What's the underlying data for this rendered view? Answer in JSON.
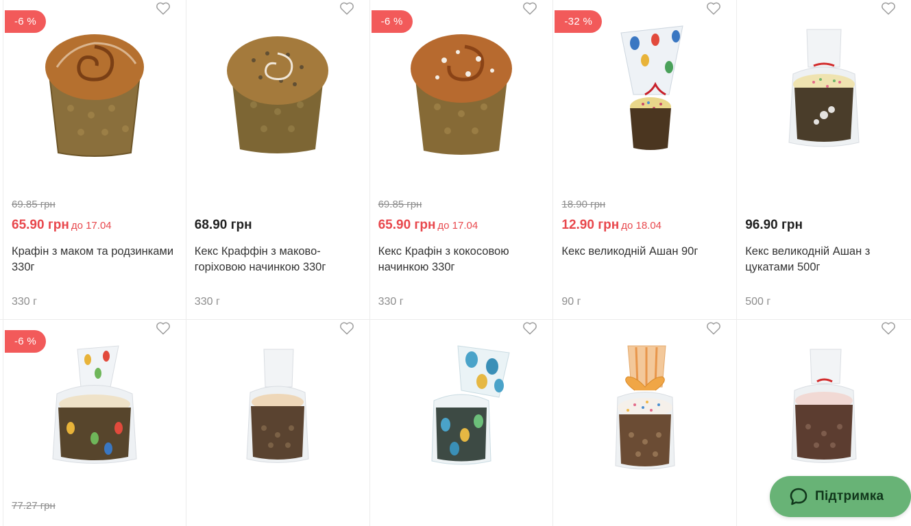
{
  "products_row1": [
    {
      "badge": "-6 %",
      "old_price": "69.85 грн",
      "price": "65.90 грн",
      "until": "до 17.04",
      "title": "Крафін з маком та родзинками 330г",
      "weight": "330 г"
    },
    {
      "badge": "",
      "old_price": "",
      "price": "68.90 грн",
      "until": "",
      "title": "Кекс Краффін з маково-горіховою начинкою 330г",
      "weight": "330 г"
    },
    {
      "badge": "-6 %",
      "old_price": "69.85 грн",
      "price": "65.90 грн",
      "until": "до 17.04",
      "title": "Кекс Крафін з кокосовою начинкою 330г",
      "weight": "330 г"
    },
    {
      "badge": "-32 %",
      "old_price": "18.90 грн",
      "price": "12.90 грн",
      "until": "до 18.04",
      "title": "Кекс великодній Ашан 90г",
      "weight": "90 г"
    },
    {
      "badge": "",
      "old_price": "",
      "price": "96.90 грн",
      "until": "",
      "title": "Кекс великодній Ашан з цукатами 500г",
      "weight": "500 г"
    }
  ],
  "products_row2": [
    {
      "badge": "-6 %",
      "old_price": "77.27 грн"
    },
    {
      "badge": ""
    },
    {
      "badge": ""
    },
    {
      "badge": ""
    },
    {
      "badge": ""
    }
  ],
  "icons": {
    "favorite": "heart-outline-icon",
    "support": "chat-bubble-icon"
  },
  "support_button": {
    "label": "Підтримка"
  },
  "colors": {
    "sale_red": "#e8474c",
    "badge_red": "#f25a5a",
    "support_green": "#68b376"
  }
}
